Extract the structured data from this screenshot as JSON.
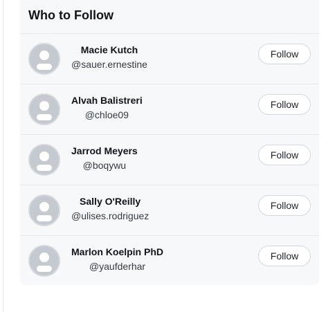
{
  "panel": {
    "title": "Who to Follow"
  },
  "users": [
    {
      "name": "Macie Kutch",
      "handle": "@sauer.ernestine",
      "button": "Follow"
    },
    {
      "name": "Alvah Balistreri",
      "handle": "@chloe09",
      "button": "Follow"
    },
    {
      "name": "Jarrod Meyers",
      "handle": "@boqywu",
      "button": "Follow"
    },
    {
      "name": "Sally O'Reilly",
      "handle": "@ulises.rodriguez",
      "button": "Follow"
    },
    {
      "name": "Marlon Koelpin PhD",
      "handle": "@yaufderhar",
      "button": "Follow"
    }
  ],
  "icons": {
    "avatar": "user-avatar-icon"
  },
  "colors": {
    "panel_bg": "#f7f8f9",
    "avatar_bg": "#c5c9d0",
    "text": "#0f1419"
  }
}
